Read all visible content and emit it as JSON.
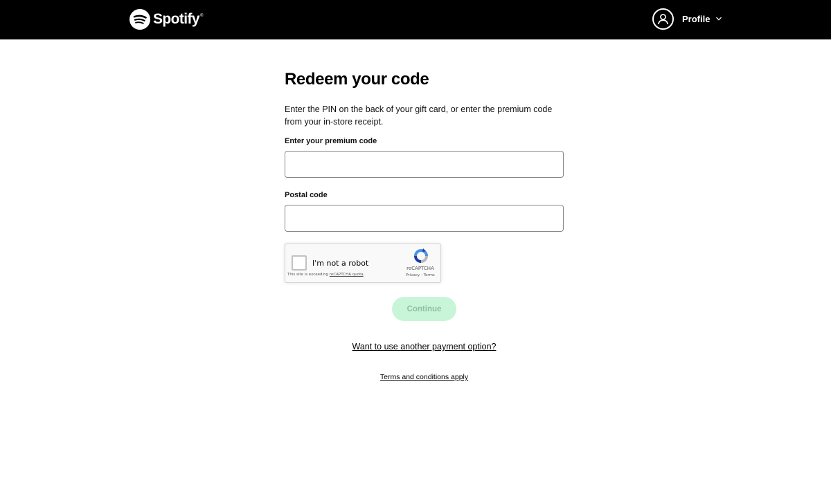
{
  "header": {
    "brand": "Spotify",
    "brand_mark": "®",
    "profile_label": "Profile",
    "icons": {
      "logo": "spotify-logo-icon",
      "avatar": "user-icon",
      "dropdown": "chevron-down-icon"
    },
    "background": "#000000"
  },
  "main": {
    "title": "Redeem your code",
    "description": "Enter the PIN on the back of your gift card, or enter the premium code from your in-store receipt.",
    "code_field": {
      "label": "Enter your premium code",
      "value": "",
      "placeholder": ""
    },
    "postal_field": {
      "label": "Postal code",
      "value": "",
      "placeholder": ""
    },
    "recaptcha": {
      "checkbox_label": "I'm not a robot",
      "note_prefix": "This site is exceeding ",
      "note_link": "reCAPTCHA quota",
      "note_suffix": ".",
      "brand": "reCAPTCHA",
      "links": "Privacy - Terms",
      "checked": false
    },
    "continue_label": "Continue",
    "continue_disabled": true,
    "payment_link": "Want to use another payment option?",
    "terms_link": "Terms and conditions apply"
  },
  "colors": {
    "accent": "#1ed760",
    "button_disabled_bg": "#c8f5d8",
    "button_disabled_text": "#8fbf9f"
  }
}
